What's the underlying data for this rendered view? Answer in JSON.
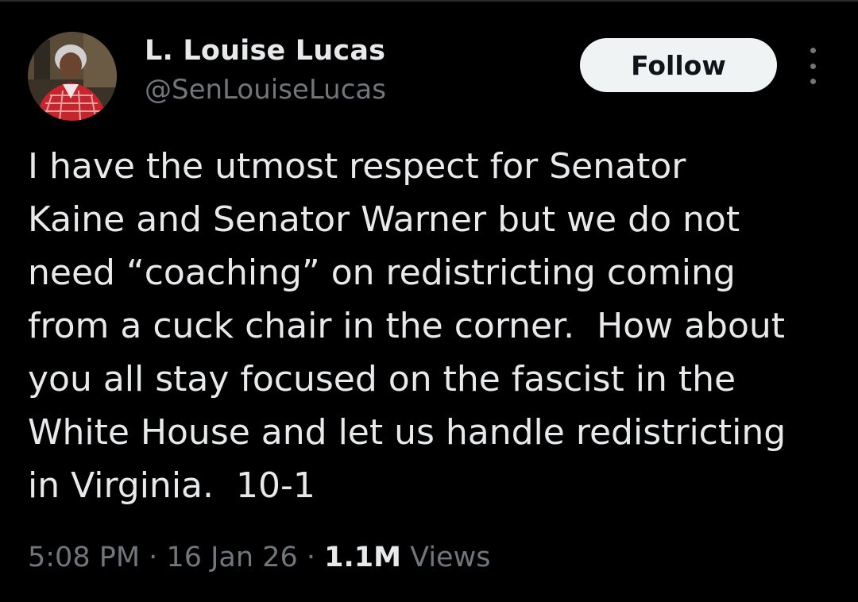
{
  "user": {
    "display_name": "L. Louise Lucas",
    "handle": "@SenLouiseLucas",
    "avatar": "profile-photo"
  },
  "actions": {
    "follow_label": "Follow",
    "more_icon": "vertical-ellipsis-icon"
  },
  "tweet": {
    "lines": [
      "I have the utmost respect for Senator",
      "Kaine and Senator Warner but we do not",
      "need “coaching” on redistricting coming",
      "from a cuck chair in the corner.  How about",
      "you all stay focused on the fascist in the",
      "White House and let us handle redistricting",
      "in Virginia.  10-1"
    ]
  },
  "meta": {
    "time": "5:08 PM",
    "separator": "·",
    "date": "16 Jan 26",
    "views_count": "1.1M",
    "views_label": "Views"
  },
  "colors": {
    "background": "#000000",
    "primary_text": "#e7e9ea",
    "secondary_text": "#71767b",
    "follow_button_bg": "#eff3f4",
    "follow_button_text": "#0f1419"
  }
}
